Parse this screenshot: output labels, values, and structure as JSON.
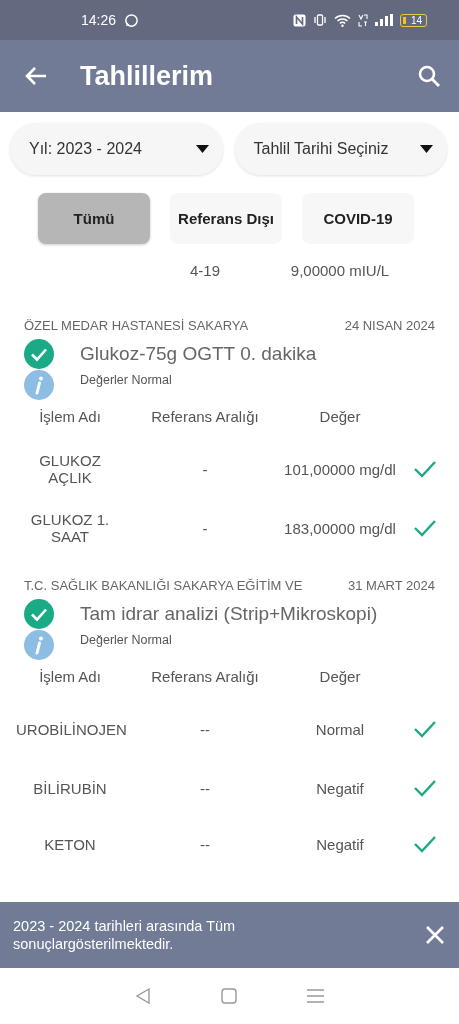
{
  "status_bar": {
    "time": "14:26",
    "battery": "14"
  },
  "app_bar": {
    "title": "Tahlillerim"
  },
  "filters": [
    {
      "label": "Yıl: 2023 - 2024"
    },
    {
      "label": "Tahlil Tarihi Seçiniz"
    }
  ],
  "tabs": [
    {
      "label": "Tümü",
      "selected": true
    },
    {
      "label": "Referans Dışı",
      "selected": false
    },
    {
      "label": "COVID-19",
      "selected": false
    }
  ],
  "partial_row": {
    "reference": "4-19",
    "value": "9,00000 mIU/L"
  },
  "results": [
    {
      "institution": "ÖZEL MEDAR HASTANESİ SAKARYA",
      "date": "24 NISAN 2024",
      "test_name": "Glukoz-75g OGTT 0. dakika",
      "status": "Değerler Normal",
      "columns": [
        "İşlem Adı",
        "Referans Aralığı",
        "Değer"
      ],
      "rows": [
        {
          "name": "GLUKOZ AÇLIK",
          "reference": "-",
          "value": "101,00000 mg/dl",
          "normal": true
        },
        {
          "name": "GLUKOZ  1. SAAT",
          "reference": "-",
          "value": "183,00000 mg/dl",
          "normal": true
        }
      ]
    },
    {
      "institution": "T.C. SAĞLIK BAKANLIĞI SAKARYA EĞİTİM VE",
      "date": "31 MART 2024",
      "test_name": "Tam idrar analizi (Strip+Mikroskopi)",
      "status": "Değerler Normal",
      "columns": [
        "İşlem Adı",
        "Referans Aralığı",
        "Değer"
      ],
      "rows": [
        {
          "name": "UROBİLİNOJEN",
          "reference": "--",
          "value": "Normal",
          "normal": true
        },
        {
          "name": "BİLİRUBİN",
          "reference": "--",
          "value": "Negatif",
          "normal": true
        },
        {
          "name": "KETON",
          "reference": "--",
          "value": "Negatif",
          "normal": true
        }
      ]
    }
  ],
  "snackbar": {
    "message": "2023 - 2024 tarihleri arasında Tüm sonuçlargösterilmektedir."
  }
}
